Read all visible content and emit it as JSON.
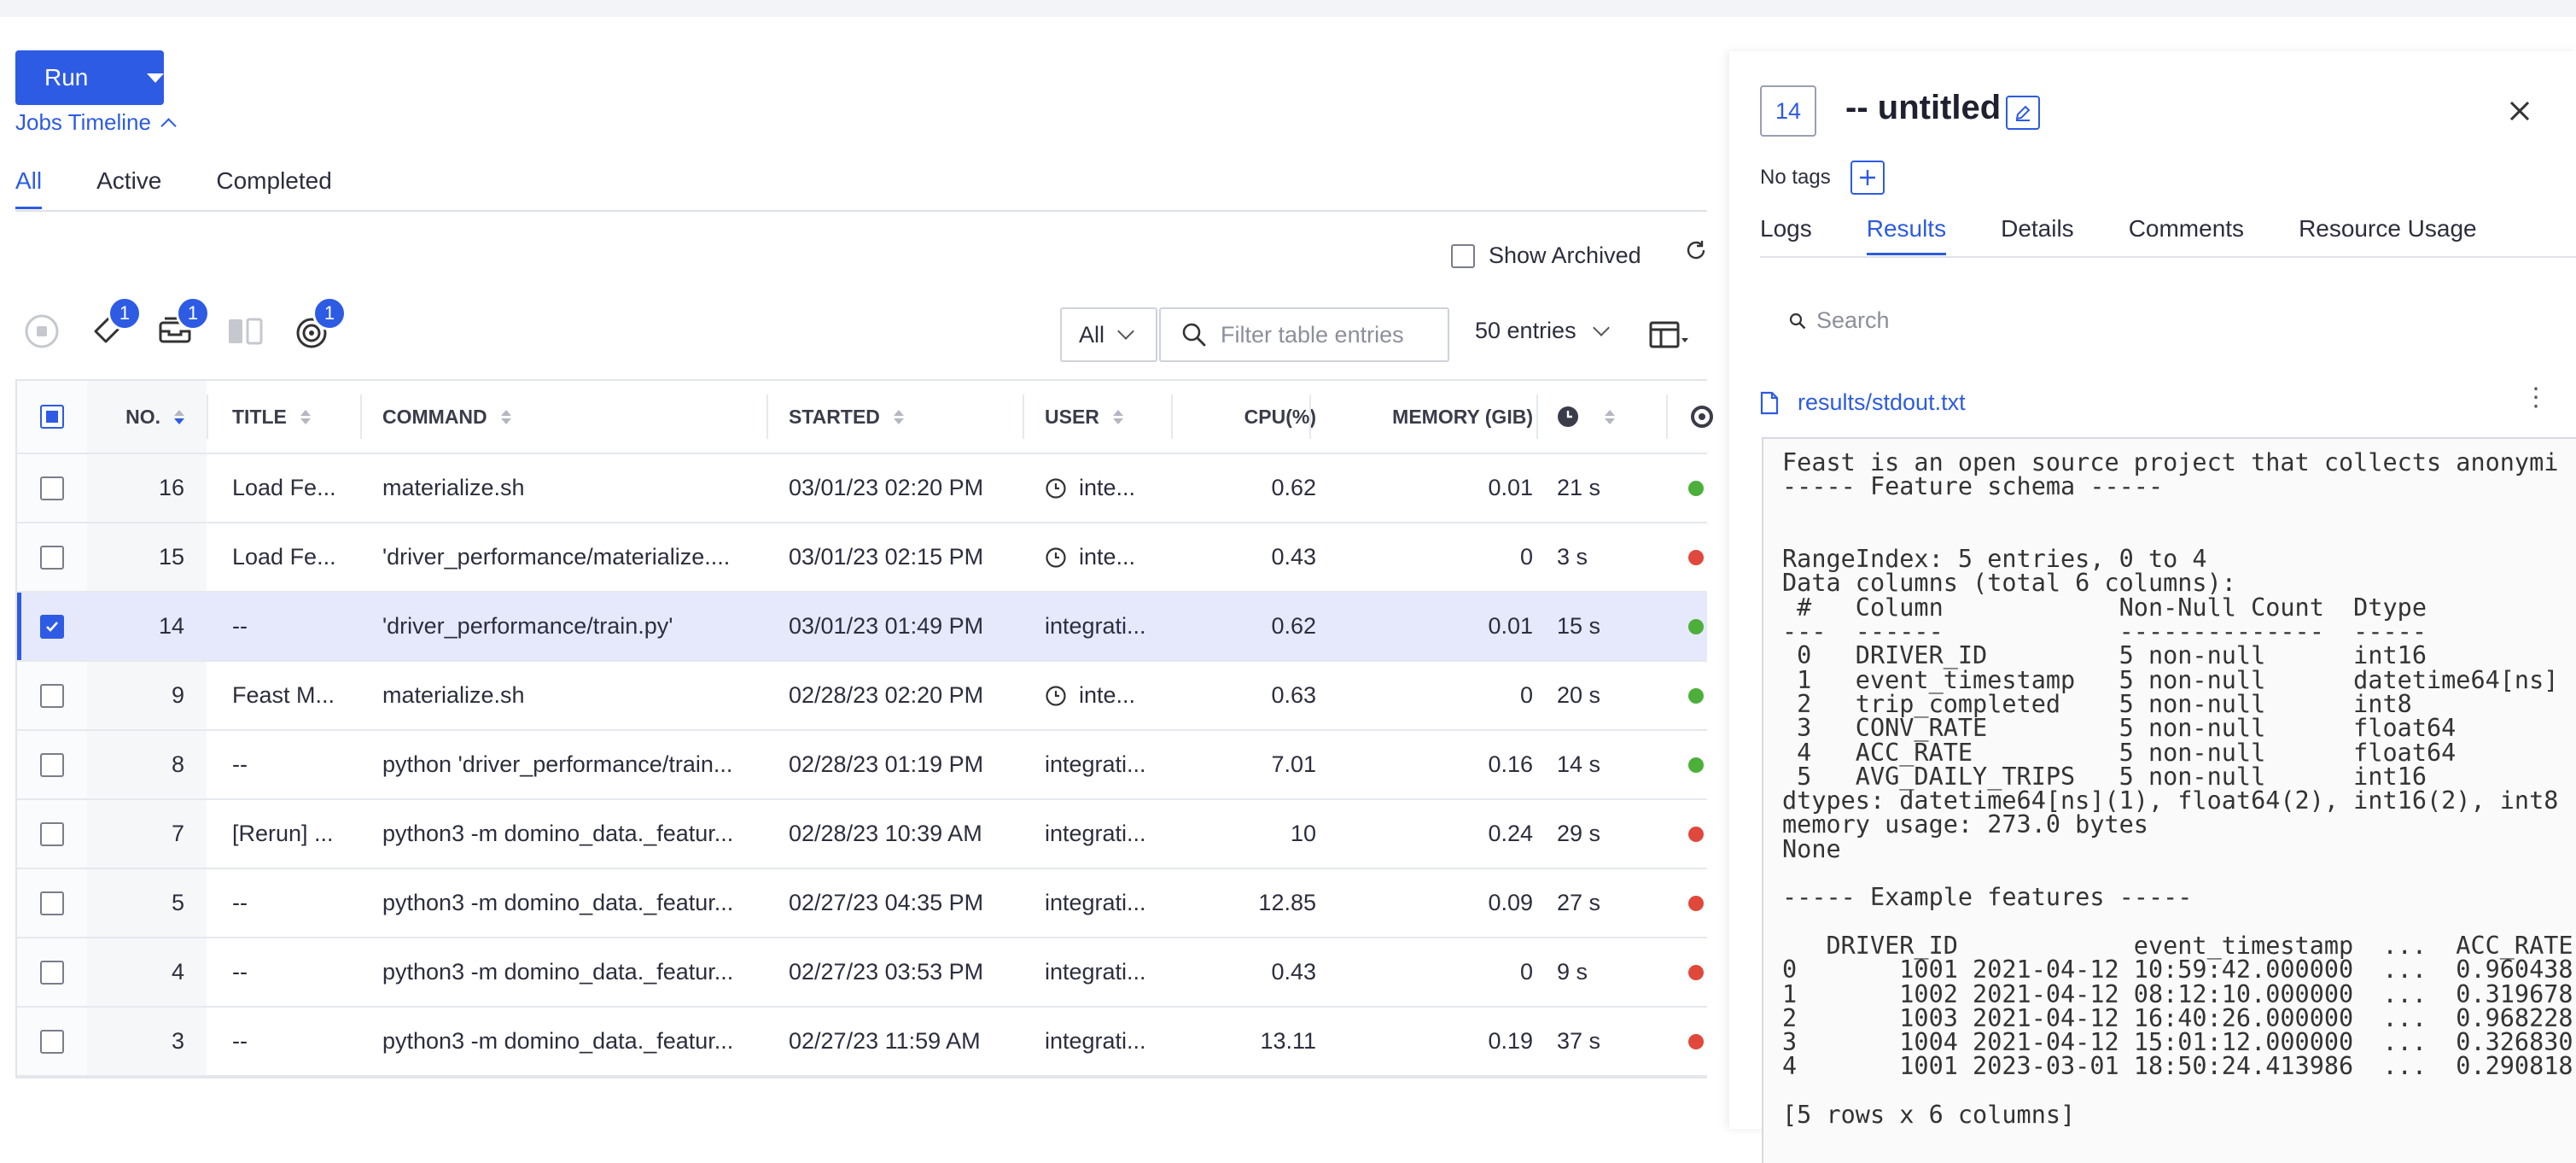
{
  "toolbar": {
    "run_label": "Run",
    "jobs_timeline_label": "Jobs Timeline"
  },
  "tabs": [
    {
      "label": "All",
      "active": true
    },
    {
      "label": "Active"
    },
    {
      "label": "Completed"
    }
  ],
  "show_archived_label": "Show Archived",
  "badges": {
    "tags": "1",
    "archive": "1",
    "target": "1"
  },
  "filter": {
    "select_value": "All",
    "search_placeholder": "Filter table entries",
    "entries_label": "50 entries"
  },
  "table": {
    "headers": {
      "no": "NO.",
      "title": "TITLE",
      "command": "COMMAND",
      "started": "STARTED",
      "user": "USER",
      "cpu": "CPU(%)",
      "memory": "MEMORY (GIB)"
    },
    "rows": [
      {
        "no": "16",
        "title": "Load Fe...",
        "command": "materialize.sh",
        "started": "03/01/23 02:20 PM",
        "user": "inte...",
        "scheduled": true,
        "cpu": "0.62",
        "mem": "0.01",
        "dur": "21 s",
        "status": "success"
      },
      {
        "no": "15",
        "title": "Load Fe...",
        "command": "'driver_performance/materialize....",
        "started": "03/01/23 02:15 PM",
        "user": "inte...",
        "scheduled": true,
        "cpu": "0.43",
        "mem": "0",
        "dur": "3 s",
        "status": "failed"
      },
      {
        "no": "14",
        "title": "--",
        "command": "'driver_performance/train.py'",
        "started": "03/01/23 01:49 PM",
        "user": "integrati...",
        "scheduled": false,
        "cpu": "0.62",
        "mem": "0.01",
        "dur": "15 s",
        "status": "success",
        "selected": true
      },
      {
        "no": "9",
        "title": "Feast M...",
        "command": "materialize.sh",
        "started": "02/28/23 02:20 PM",
        "user": "inte...",
        "scheduled": true,
        "cpu": "0.63",
        "mem": "0",
        "dur": "20 s",
        "status": "success"
      },
      {
        "no": "8",
        "title": "--",
        "command": "python 'driver_performance/train...",
        "started": "02/28/23 01:19 PM",
        "user": "integrati...",
        "scheduled": false,
        "cpu": "7.01",
        "mem": "0.16",
        "dur": "14 s",
        "status": "success"
      },
      {
        "no": "7",
        "title": "[Rerun] ...",
        "command": "python3 -m domino_data._featur...",
        "started": "02/28/23 10:39 AM",
        "user": "integrati...",
        "scheduled": false,
        "cpu": "10",
        "mem": "0.24",
        "dur": "29 s",
        "status": "failed"
      },
      {
        "no": "5",
        "title": "--",
        "command": "python3 -m domino_data._featur...",
        "started": "02/27/23 04:35 PM",
        "user": "integrati...",
        "scheduled": false,
        "cpu": "12.85",
        "mem": "0.09",
        "dur": "27 s",
        "status": "failed"
      },
      {
        "no": "4",
        "title": "--",
        "command": "python3 -m domino_data._featur...",
        "started": "02/27/23 03:53 PM",
        "user": "integrati...",
        "scheduled": false,
        "cpu": "0.43",
        "mem": "0",
        "dur": "9 s",
        "status": "failed"
      },
      {
        "no": "3",
        "title": "--",
        "command": "python3 -m domino_data._featur...",
        "started": "02/27/23 11:59 AM",
        "user": "integrati...",
        "scheduled": false,
        "cpu": "13.11",
        "mem": "0.19",
        "dur": "37 s",
        "status": "failed"
      }
    ]
  },
  "colors": {
    "accent": "#2d5be3",
    "success": "#4caf3a",
    "failed": "#e0483b"
  },
  "detail": {
    "number": "14",
    "title": "-- untitled",
    "no_tags": "No tags",
    "tabs": [
      {
        "label": "Logs"
      },
      {
        "label": "Results",
        "active": true
      },
      {
        "label": "Details"
      },
      {
        "label": "Comments"
      },
      {
        "label": "Resource Usage"
      }
    ],
    "search_placeholder": "Search",
    "file_name": "results/stdout.txt",
    "output": "Feast is an open source project that collects anonymi\n----- Feature schema -----\n\n\nRangeIndex: 5 entries, 0 to 4\nData columns (total 6 columns):\n #   Column            Non-Null Count  Dtype\n---  ------            --------------  -----\n 0   DRIVER_ID         5 non-null      int16\n 1   event_timestamp   5 non-null      datetime64[ns]\n 2   trip_completed    5 non-null      int8\n 3   CONV_RATE         5 non-null      float64\n 4   ACC_RATE          5 non-null      float64\n 5   AVG_DAILY_TRIPS   5 non-null      int16\ndtypes: datetime64[ns](1), float64(2), int16(2), int8\nmemory usage: 273.0 bytes\nNone\n\n----- Example features -----\n\n   DRIVER_ID            event_timestamp  ...  ACC_RATE\n0       1001 2021-04-12 10:59:42.000000  ...  0.960438\n1       1002 2021-04-12 08:12:10.000000  ...  0.319678\n2       1003 2021-04-12 16:40:26.000000  ...  0.968228\n3       1004 2021-04-12 15:01:12.000000  ...  0.326830\n4       1001 2023-03-01 18:50:24.413986  ...  0.290818\n\n[5 rows x 6 columns]"
  }
}
